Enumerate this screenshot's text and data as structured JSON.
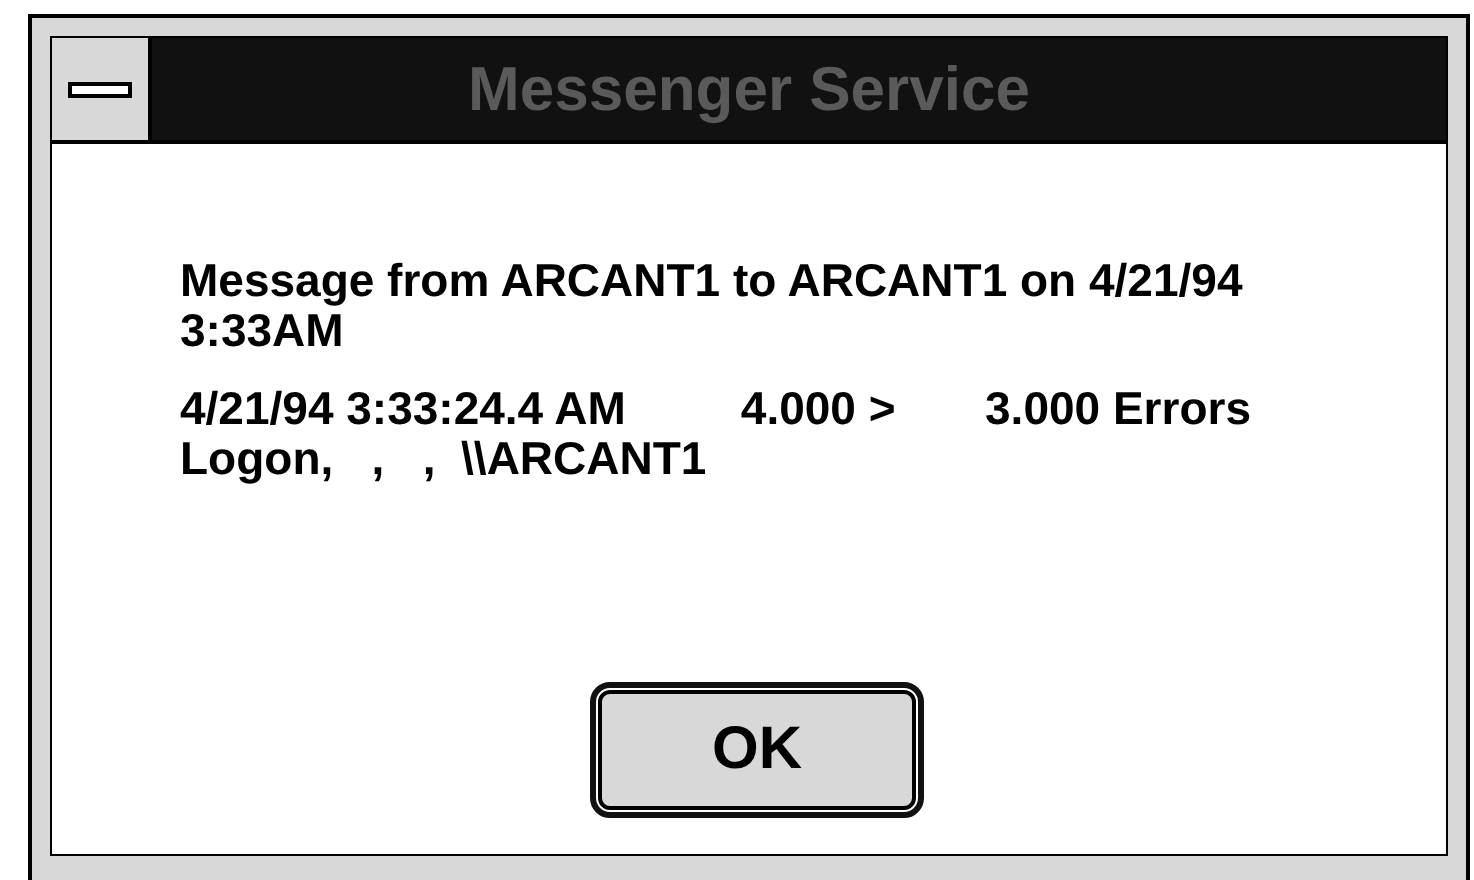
{
  "window": {
    "title": "Messenger Service"
  },
  "messages": [
    "Message from ARCANT1 to ARCANT1 on 4/21/94 3:33AM",
    "4/21/94 3:33:24.4 AM         4.000 >       3.000 Errors Logon,   ,   ,  \\\\ARCANT1"
  ],
  "buttons": [
    {
      "label": "OK",
      "selected": true
    }
  ]
}
